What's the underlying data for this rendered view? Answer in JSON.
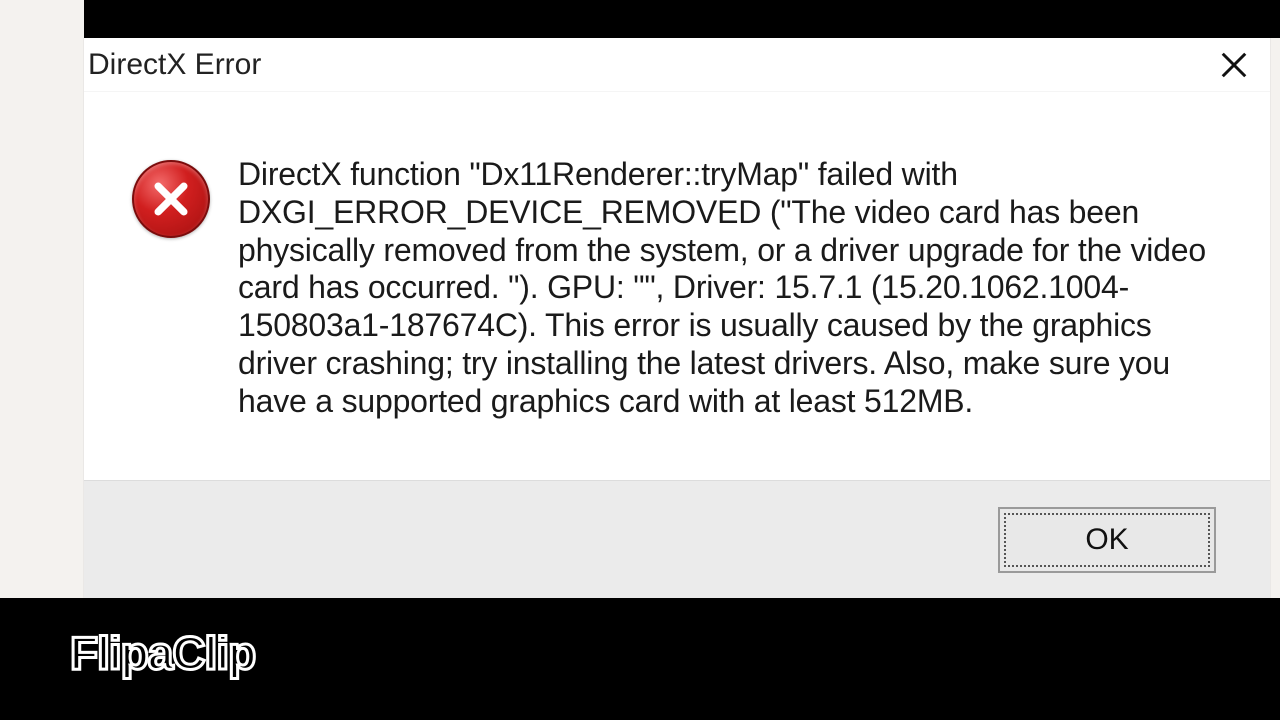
{
  "dialog": {
    "title": "DirectX Error",
    "message": "DirectX function \"Dx11Renderer::tryMap\" failed with DXGI_ERROR_DEVICE_REMOVED (\"The video card has been physically removed from the system, or a driver upgrade for the video card has occurred. \"). GPU: \"\", Driver: 15.7.1 (15.20.1062.1004-150803a1-187674C). This error is usually caused by the graphics driver crashing; try installing the latest drivers. Also, make sure you have a supported graphics card with at least 512MB.",
    "ok_label": "OK"
  },
  "watermark": "FlipaClip"
}
